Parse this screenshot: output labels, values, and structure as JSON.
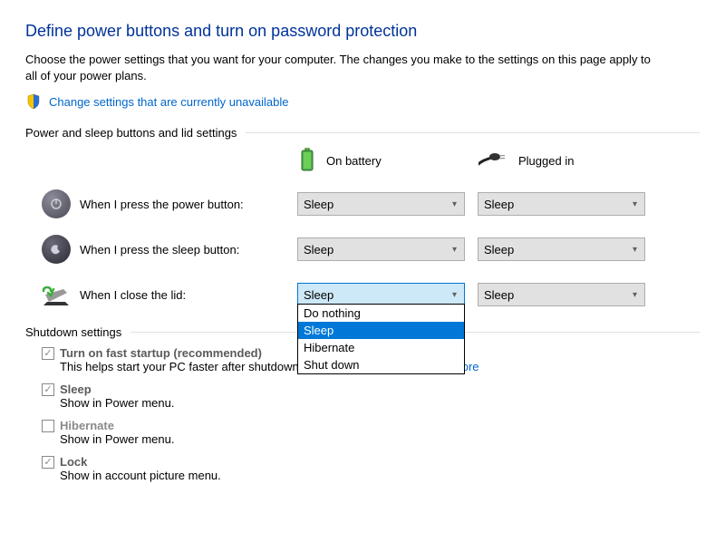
{
  "title": "Define power buttons and turn on password protection",
  "subtitle": "Choose the power settings that you want for your computer. The changes you make to the settings on this page apply to all of your power plans.",
  "change_link": "Change settings that are currently unavailable",
  "section1": {
    "title": "Power and sleep buttons and lid settings",
    "col_battery": "On battery",
    "col_plugged": "Plugged in",
    "rows": {
      "power": {
        "label": "When I press the power button:",
        "battery": "Sleep",
        "plugged": "Sleep"
      },
      "sleep": {
        "label": "When I press the sleep button:",
        "battery": "Sleep",
        "plugged": "Sleep"
      },
      "lid": {
        "label": "When I close the lid:",
        "battery": "Sleep",
        "plugged": "Sleep"
      }
    },
    "dropdown": {
      "opt0": "Do nothing",
      "opt1": "Sleep",
      "opt2": "Hibernate",
      "opt3": "Shut down"
    }
  },
  "section2": {
    "title": "Shutdown settings",
    "items": {
      "fast": {
        "label": "Turn on fast startup (recommended)",
        "desc_pre": "This helps start your PC faster after shutdown. Restart isn't affected. ",
        "learn": "Learn More"
      },
      "sleep": {
        "label": "Sleep",
        "desc": "Show in Power menu."
      },
      "hiber": {
        "label": "Hibernate",
        "desc": "Show in Power menu."
      },
      "lock": {
        "label": "Lock",
        "desc": "Show in account picture menu."
      }
    }
  }
}
